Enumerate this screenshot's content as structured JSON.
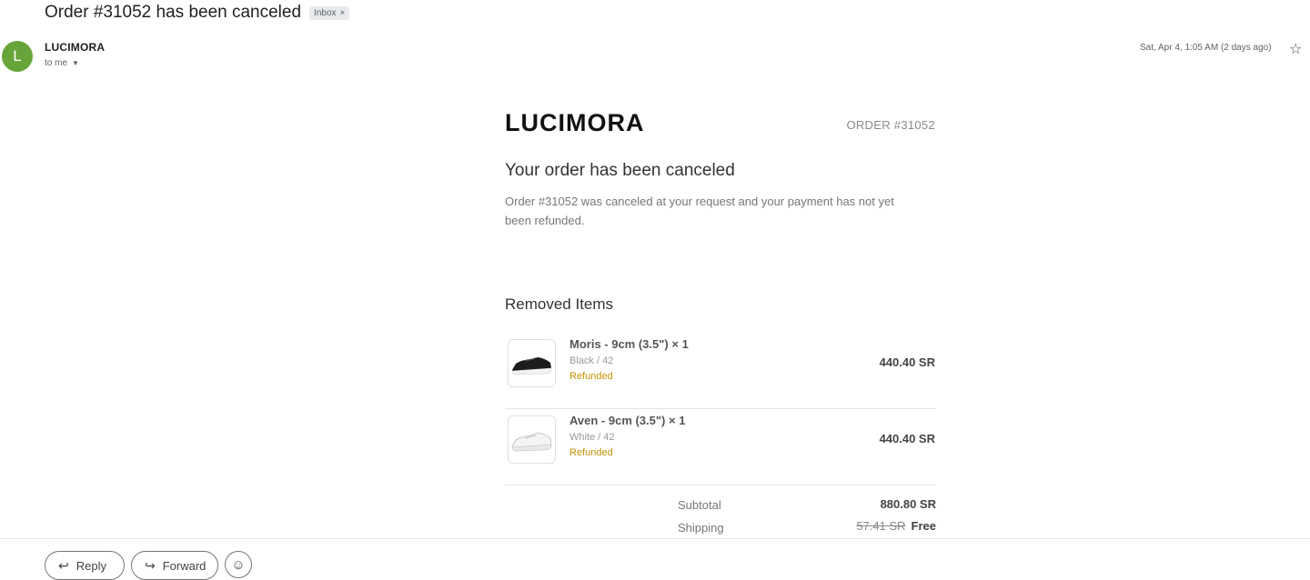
{
  "email": {
    "subject": "Order #31052 has been canceled",
    "label": "Inbox",
    "label_close": "×",
    "sender": {
      "avatar_letter": "L",
      "avatar_color": "#67a53b",
      "name": "LUCIMORA",
      "to": "to me"
    },
    "date": "Sat, Apr 4, 1:05 AM (2 days ago)"
  },
  "body": {
    "logo": "LUCIMORA",
    "order_label": "ORDER #31052",
    "headline": "Your order has been canceled",
    "message": "Order #31052 was canceled at your request and your payment has not yet been refunded.",
    "section_title": "Removed Items",
    "items": [
      {
        "name": "Moris - 9cm (3.5\") × 1",
        "variant": "Black / 42",
        "status": "Refunded",
        "price": "440.40 SR",
        "image": "black-sneaker"
      },
      {
        "name": "Aven - 9cm (3.5\") × 1",
        "variant": "White / 42",
        "status": "Refunded",
        "price": "440.40 SR",
        "image": "white-sneaker"
      }
    ],
    "totals": {
      "subtotal_label": "Subtotal",
      "subtotal_value": "880.80 SR",
      "shipping_label": "Shipping",
      "shipping_original": "57.41 SR",
      "shipping_value": "Free"
    }
  },
  "actions": {
    "reply": "Reply",
    "forward": "Forward",
    "reply_icon": "reply-icon",
    "forward_icon": "forward-icon",
    "emoji_icon": "emoji-icon"
  },
  "colors": {
    "refunded": "#c59200",
    "muted": "#777777"
  }
}
